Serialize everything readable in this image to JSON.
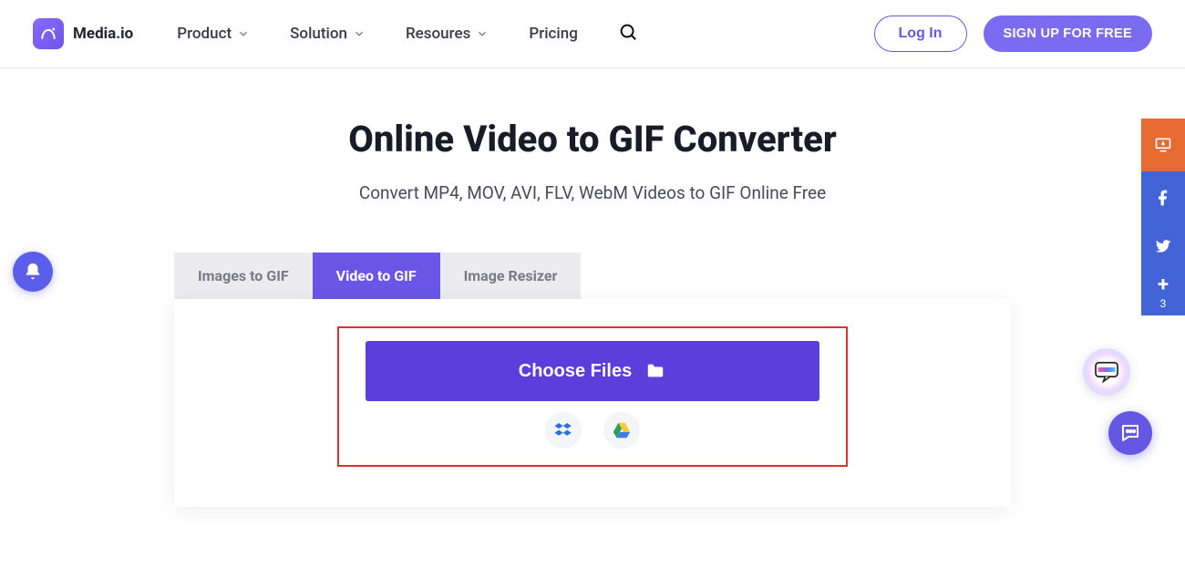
{
  "header": {
    "brand": "Media.io",
    "nav": [
      "Product",
      "Solution",
      "Resoures",
      "Pricing"
    ],
    "login_label": "Log In",
    "signup_label": "SIGN UP FOR FREE"
  },
  "page": {
    "title": "Online Video to GIF Converter",
    "subtitle": "Convert MP4, MOV, AVI, FLV, WebM Videos to GIF Online Free"
  },
  "tabs": {
    "items": [
      "Images to GIF",
      "Video to GIF",
      "Image Resizer"
    ],
    "active_index": 1
  },
  "upload": {
    "choose_label": "Choose Files",
    "cloud_sources": [
      "dropbox",
      "google-drive"
    ]
  },
  "share_rail": {
    "count": "3"
  },
  "colors": {
    "accent": "#6b55e6",
    "accent_dark": "#5b3edc",
    "rail_orange": "#e76a33",
    "rail_blue": "#4264d6",
    "highlight_border": "#d8322c"
  }
}
